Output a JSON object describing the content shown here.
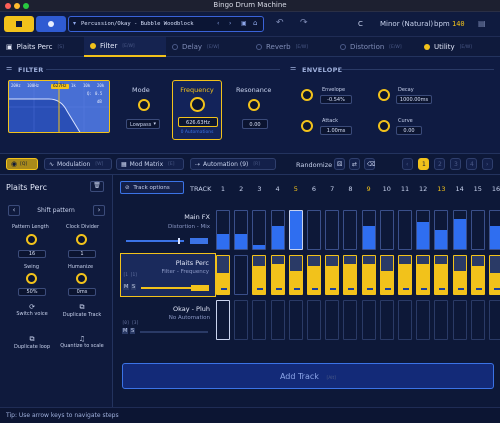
{
  "window": {
    "title": "Bingo Drum Machine"
  },
  "toolbar": {
    "preset_path": "Percussion/Okay - Bubble Woodblock",
    "key": "C",
    "scale": "Minor (Natural)",
    "bpm_label": "bpm",
    "bpm_value": "140"
  },
  "tabs": [
    {
      "label": "Plaits Perc",
      "shortcut": "[S]"
    },
    {
      "label": "Filter",
      "shortcut": "[E/W]"
    },
    {
      "label": "Delay",
      "shortcut": "[E/W]"
    },
    {
      "label": "Reverb",
      "shortcut": "[E/W]"
    },
    {
      "label": "Distortion",
      "shortcut": "[E/W]"
    },
    {
      "label": "Utility",
      "shortcut": "[E/W]"
    }
  ],
  "filter": {
    "section_title": "FILTER",
    "graph_labels": {
      "hz20": "20Hz",
      "hz100": "100Hz",
      "hz1k": "1k",
      "hz10k": "10k",
      "hz20k": "20k",
      "db": "dB",
      "q": "Q:",
      "q_val": "0.5"
    },
    "freq_marker": "627Hz",
    "mode_label": "Mode",
    "mode_value": "Lowpass",
    "frequency_label": "Frequency",
    "frequency_value": "626.63Hz",
    "frequency_automations": "0 Automations",
    "resonance_label": "Resonance",
    "resonance_value": "0.00"
  },
  "envelope": {
    "section_title": "ENVELOPE",
    "envelope_label": "Envelope",
    "envelope_value": "-0.54%",
    "decay_label": "Decay",
    "decay_value": "1000.00ms",
    "attack_label": "Attack",
    "attack_value": "1.00ms",
    "curve_label": "Curve",
    "curve_value": "0.00"
  },
  "bar": {
    "eye_shortcut": "[Q]",
    "modulation_label": "Modulation",
    "modulation_shortcut": "[W]",
    "mod_matrix_label": "Mod Matrix",
    "mod_matrix_shortcut": "[E]",
    "automation_label": "Automation (9)",
    "automation_shortcut": "[R]",
    "randomize_label": "Randomize",
    "pages": [
      "1",
      "2",
      "3",
      "4"
    ]
  },
  "left_panel": {
    "title": "Plaits Perc",
    "shift_pattern": "Shift pattern",
    "pattern_length_label": "Pattern Length",
    "pattern_length_value": "16",
    "clock_divider_label": "Clock Divider",
    "clock_divider_value": "1",
    "swing_label": "Swing",
    "swing_value": "50%",
    "humanize_label": "Humanize",
    "humanize_value": "0ms",
    "switch_voice": "Switch voice",
    "duplicate_track": "Duplicate Track",
    "duplicate_loop": "Duplicate loop",
    "quantize": "Quantize to scale"
  },
  "sequencer": {
    "track_options": "Track options",
    "track_label": "TRACK",
    "step_numbers": [
      "1",
      "2",
      "3",
      "4",
      "5",
      "6",
      "7",
      "8",
      "9",
      "10",
      "11",
      "12",
      "13",
      "14",
      "15",
      "16"
    ],
    "tracks": [
      {
        "name": "Main FX",
        "subtitle": "Distortion - Mix",
        "shortcut": ""
      },
      {
        "name": "Plaits Perc",
        "subtitle": "Filter - Frequency",
        "shortcut": "[1 [1]"
      },
      {
        "name": "Okay - Pluh",
        "subtitle": "No Automation",
        "shortcut": "[0] [3]"
      }
    ],
    "add_track": "Add Track",
    "add_track_shortcut": "[Alt]"
  },
  "status": {
    "tip": "Tip: Use arrow keys to navigate steps"
  },
  "colors": {
    "accent": "#f2c21b",
    "blue": "#3b73e6",
    "bg": "#0d1838"
  }
}
